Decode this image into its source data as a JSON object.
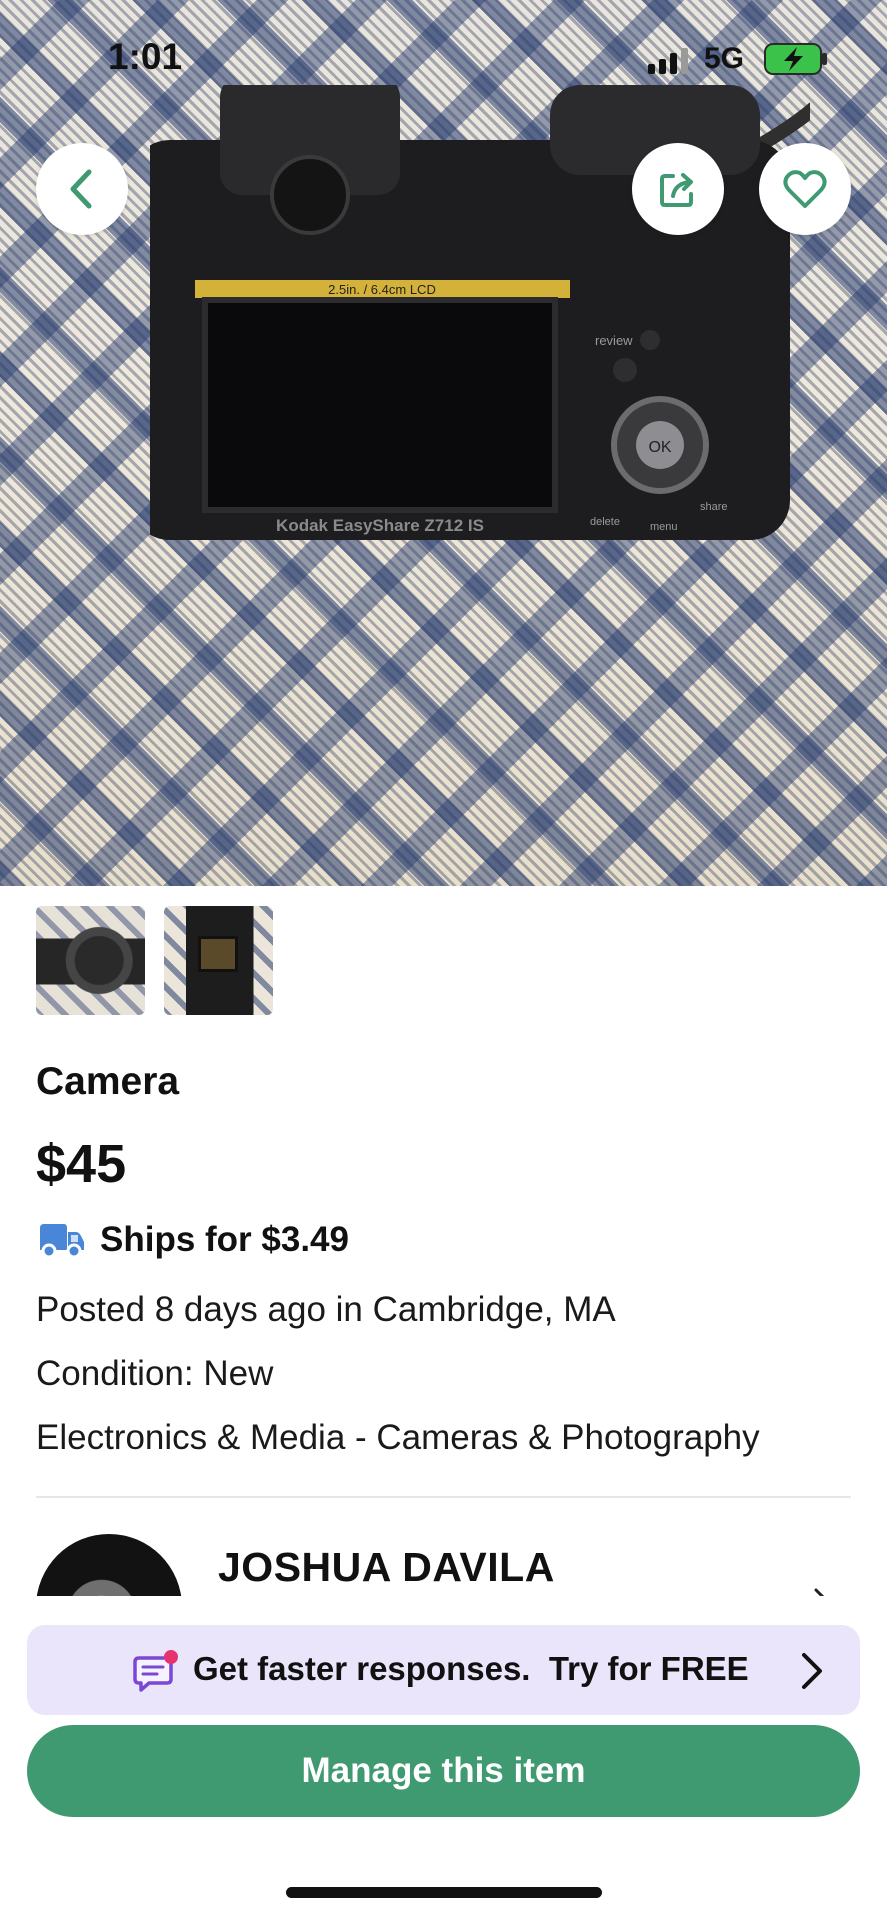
{
  "status_bar": {
    "time": "1:01",
    "network": "5G"
  },
  "header": {
    "back_icon": "chevron-left-icon",
    "share_icon": "share-icon",
    "favorite_icon": "heart-icon",
    "accent_color": "#3f9a72"
  },
  "photo": {
    "camera_brand_text": "Kodak EasyShare Z712 IS",
    "lcd_label": "2.5in. / 6.4cm LCD",
    "buttons": [
      "review",
      "OK",
      "delete",
      "menu",
      "share"
    ],
    "thumbnail_count": 2
  },
  "listing": {
    "title": "Camera",
    "price": "$45",
    "shipping": "Ships for $3.49",
    "posted": "Posted 8 days ago in Cambridge, MA",
    "condition": "Condition: New",
    "category": "Electronics & Media - Cameras & Photography"
  },
  "seller": {
    "name": "JOSHUA DAVILA"
  },
  "promo": {
    "text": "Get faster responses.  Try for FREE",
    "icon": "message-icon",
    "background": "#ebe5fb"
  },
  "actions": {
    "manage_label": "Manage this item",
    "color": "#3f9a72"
  }
}
